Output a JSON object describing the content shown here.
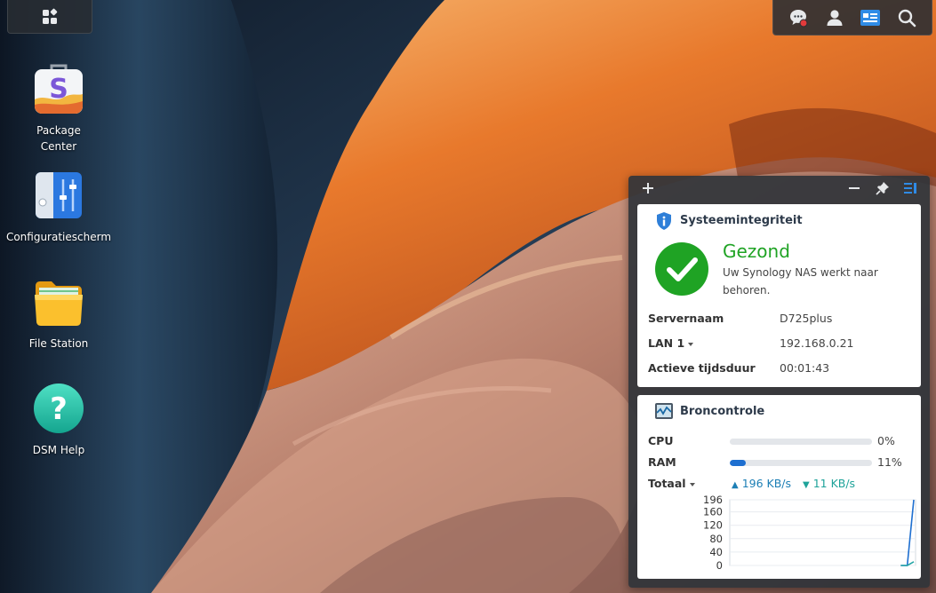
{
  "topbar": {
    "main_menu_icon": "grid-icon",
    "tray_icons": [
      "notification-icon",
      "user-icon",
      "widgets-icon",
      "search-icon"
    ],
    "notification_badge_color": "#e23b3b"
  },
  "desktop": {
    "icons": [
      {
        "label": "Package Center",
        "icon": "package-center-icon"
      },
      {
        "label": "Configuratiescherm",
        "icon": "control-panel-icon"
      },
      {
        "label": "File Station",
        "icon": "folder-icon"
      },
      {
        "label": "DSM Help",
        "icon": "help-icon"
      }
    ]
  },
  "widgets": {
    "header_icons": [
      "plus-icon",
      "minimize-icon",
      "pin-icon",
      "widget-layout-icon"
    ],
    "system_health": {
      "title": "Systeemintegriteit",
      "status": "Gezond",
      "message": "Uw Synology NAS werkt naar behoren.",
      "status_color": "#1fa324",
      "rows": [
        {
          "label": "Servernaam",
          "value": "D725plus"
        },
        {
          "label": "LAN 1",
          "value": "192.168.0.21",
          "dropdown": true
        },
        {
          "label": "Actieve tijdsduur",
          "value": "00:01:43"
        }
      ]
    },
    "resource_monitor": {
      "title": "Broncontrole",
      "cpu": {
        "label": "CPU",
        "percent": 0,
        "text": "0%"
      },
      "ram": {
        "label": "RAM",
        "percent": 11,
        "text": "11%"
      },
      "total_label": "Totaal",
      "upload": "196 KB/s",
      "download": "11 KB/s",
      "accent": "#1e6fd0",
      "rate_color": "#1d7fb5"
    }
  },
  "chart_data": {
    "type": "line",
    "yticks": [
      "196",
      "160",
      "120",
      "80",
      "40",
      "0"
    ],
    "ylim": [
      0,
      196
    ],
    "series": [
      {
        "values": [
          0,
          0,
          0,
          0,
          0,
          0,
          0,
          0,
          0,
          0,
          0,
          0,
          0,
          0,
          0,
          0,
          0,
          0,
          0,
          0,
          0,
          0,
          0,
          0,
          0,
          0,
          0,
          0,
          196
        ],
        "color": "#1e6fd0"
      },
      {
        "values": [
          0,
          0,
          0,
          0,
          0,
          0,
          0,
          0,
          0,
          0,
          0,
          0,
          0,
          0,
          0,
          0,
          0,
          0,
          0,
          0,
          0,
          0,
          0,
          0,
          0,
          0,
          0,
          0,
          11
        ],
        "color": "#26a6a6"
      }
    ]
  }
}
